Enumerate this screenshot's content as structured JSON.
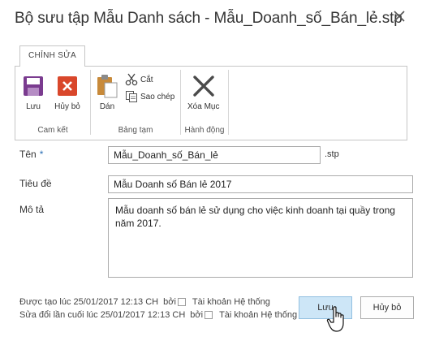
{
  "dialog": {
    "title": "Bộ sưu tập Mẫu Danh sách - Mẫu_Doanh_số_Bán_lẻ.stp",
    "close_icon": "close-icon"
  },
  "ribbon": {
    "tab_label": "CHỈNH SỬA",
    "groups": {
      "commit": {
        "label": "Cam kết",
        "save_label": "Lưu",
        "cancel_label": "Hủy bỏ"
      },
      "clipboard": {
        "label": "Bảng tạm",
        "paste_label": "Dán",
        "cut_label": "Cắt",
        "copy_label": "Sao chép"
      },
      "actions": {
        "label": "Hành động",
        "delete_label": "Xóa Mục"
      }
    }
  },
  "form": {
    "name_label": "Tên",
    "name_required": "*",
    "name_value": "Mẫu_Doanh_số_Bán_lẻ",
    "name_suffix": ".stp",
    "title_label": "Tiêu đề",
    "title_value": "Mẫu Doanh số Bán lẻ 2017",
    "description_label": "Mô tả",
    "description_value": "Mẫu doanh số bán lẻ sử dụng cho việc kinh doanh tại quầy trong năm 2017."
  },
  "footer": {
    "created_text": "Được tạo lúc 25/01/2017 12:13 CH",
    "created_by_prefix": "bởi",
    "created_by": "Tài khoản Hệ thống",
    "modified_text": "Sửa đổi lần cuối lúc 25/01/2017 12:13 CH",
    "modified_by_prefix": "bởi",
    "modified_by": "Tài khoản Hệ thống",
    "save_button": "Lưu",
    "cancel_button": "Hủy bỏ"
  },
  "colors": {
    "save_icon": "#7a3b8f",
    "cancel_icon": "#d9472b",
    "primary_button": "#cde6f7",
    "required_marker": "#2a6fb5"
  }
}
